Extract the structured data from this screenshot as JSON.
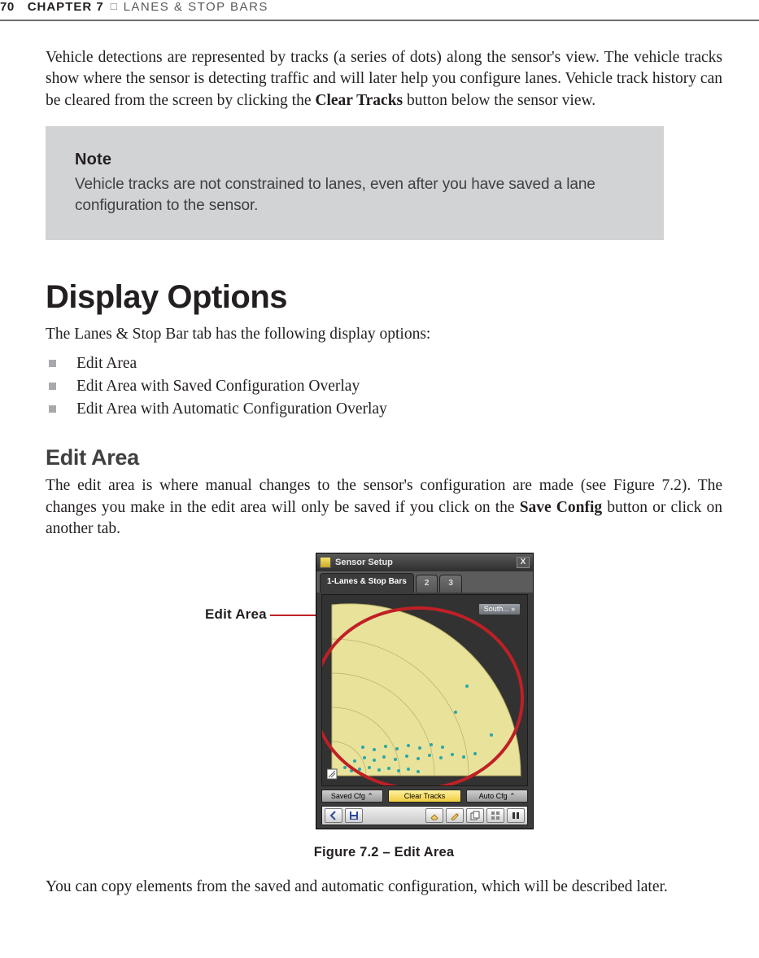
{
  "header": {
    "page_number": "70",
    "chapter_label": "CHAPTER 7",
    "separator": "□",
    "chapter_title": "LANES & STOP BARS"
  },
  "intro_paragraph": {
    "part1": "Vehicle detections are represented by tracks (a series of dots) along the sensor's view. The vehicle tracks show where the sensor is detecting traffic and will later help you configure lanes. Vehicle track history can be cleared from the screen by clicking the ",
    "bold": "Clear Tracks",
    "part2": " button below the sensor view."
  },
  "note": {
    "title": "Note",
    "body": "Vehicle tracks are not constrained to lanes, even after you have saved a lane configuration to the sensor."
  },
  "section_heading": "Display Options",
  "list_intro": "The Lanes & Stop Bar tab has the following display options:",
  "options": [
    "Edit Area",
    "Edit Area with Saved Configuration Overlay",
    "Edit Area with Automatic Configuration Overlay"
  ],
  "subsection_heading": "Edit Area",
  "edit_area_paragraph": {
    "part1": "The edit area is where manual changes to the sensor's configuration are made (see Figure 7.2). The changes you make in the edit area will only be saved if you click on the ",
    "bold": "Save Config",
    "part2": " button or click on another tab."
  },
  "figure": {
    "callout_label": "Edit Area",
    "window_title": "Sensor Setup",
    "tabs": {
      "active": "1-Lanes & Stop Bars",
      "t2": "2",
      "t3": "3"
    },
    "direction_button": "South... »",
    "cfg_buttons": {
      "saved": "Saved Cfg ⌃",
      "clear": "Clear Tracks",
      "auto": "Auto Cfg ⌃"
    },
    "caption": "Figure 7.2 – Edit Area"
  },
  "closing_paragraph": "You can copy elements from the saved and automatic configuration, which will be described later."
}
